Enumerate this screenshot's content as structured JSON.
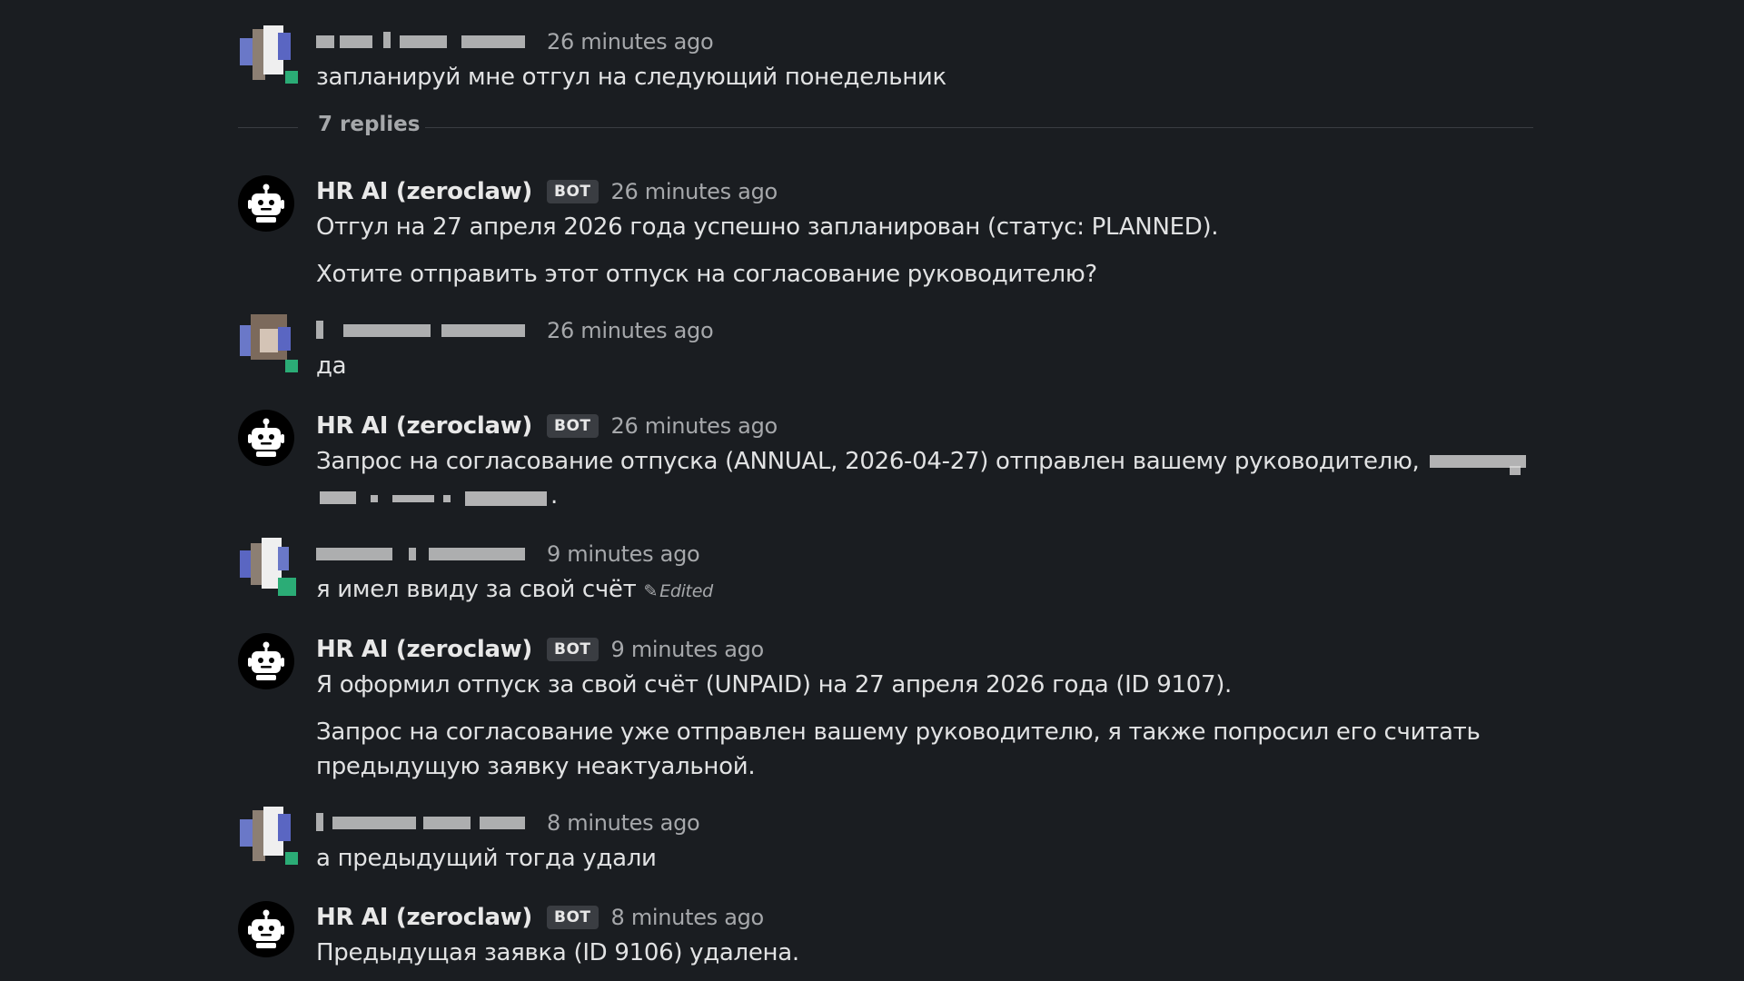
{
  "thread": {
    "parent": {
      "author": "",
      "time": "26 minutes ago",
      "text": "запланируй мне отгул на следующий понедельник"
    },
    "replies_label": "7 replies",
    "messages": [
      {
        "author": "HR AI (zeroclaw)",
        "badge": "BOT",
        "time": "26 minutes ago",
        "paragraphs": [
          "Отгул на 27 апреля 2026 года успешно запланирован (статус: PLANNED).",
          "Хотите отправить этот отпуск на согласование руководителю?"
        ]
      },
      {
        "author": "",
        "time": "26 minutes ago",
        "paragraphs": [
          "да"
        ]
      },
      {
        "author": "HR AI (zeroclaw)",
        "badge": "BOT",
        "time": "26 minutes ago",
        "paragraphs": [
          "Запрос на согласование отпуска (ANNUAL, 2026-04-27) отправлен вашему руководителю,"
        ],
        "trailing": "."
      },
      {
        "author": "",
        "time": "9 minutes ago",
        "paragraphs": [
          "я имел ввиду за свой счёт"
        ],
        "edited": "Edited"
      },
      {
        "author": "HR AI (zeroclaw)",
        "badge": "BOT",
        "time": "9 minutes ago",
        "paragraphs": [
          "Я оформил отпуск за свой счёт (UNPAID) на 27 апреля 2026 года (ID 9107).",
          "Запрос на согласование уже отправлен вашему руководителю, я также попросил его считать",
          "предыдущую заявку неактуальной."
        ]
      },
      {
        "author": "",
        "time": "8 minutes ago",
        "paragraphs": [
          "а предыдущий тогда удали"
        ]
      },
      {
        "author": "HR AI (zeroclaw)",
        "badge": "BOT",
        "time": "8 minutes ago",
        "paragraphs": [
          "Предыдущая заявка (ID 9106) удалена."
        ]
      }
    ]
  },
  "icons": {
    "bot": "robot-icon",
    "pencil": "pencil-icon"
  },
  "colors": {
    "background": "#1a1d21",
    "presence": "#2bac76",
    "muted": "#a6a8ab"
  }
}
